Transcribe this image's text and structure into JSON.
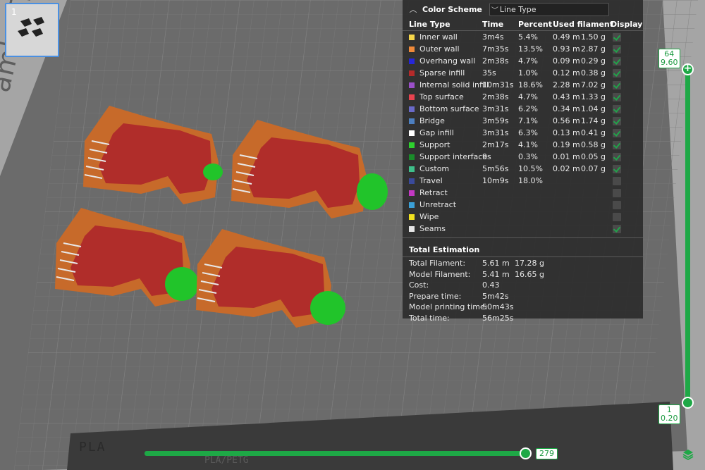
{
  "plate": {
    "label": "ambu Textured PEI Plate",
    "bottom_logo": "PLA",
    "bottom_text": "PLA/PETG"
  },
  "thumbnail": {
    "number": "1"
  },
  "legend": {
    "title": "Color Scheme",
    "scheme_value": "Line Type",
    "columns": {
      "type": "Line Type",
      "time": "Time",
      "percent": "Percent",
      "used": "Used filament",
      "display": "Display"
    },
    "rows": [
      {
        "name": "Inner wall",
        "color": "#f5d64a",
        "time": "3m4s",
        "percent": "5.4%",
        "m": "0.49 m",
        "g": "1.50 g",
        "display": true
      },
      {
        "name": "Outer wall",
        "color": "#f08a3a",
        "time": "7m35s",
        "percent": "13.5%",
        "m": "0.93 m",
        "g": "2.87 g",
        "display": true
      },
      {
        "name": "Overhang wall",
        "color": "#2727d8",
        "time": "2m38s",
        "percent": "4.7%",
        "m": "0.09 m",
        "g": "0.29 g",
        "display": true
      },
      {
        "name": "Sparse infill",
        "color": "#b52a2a",
        "time": "35s",
        "percent": "1.0%",
        "m": "0.12 m",
        "g": "0.38 g",
        "display": true
      },
      {
        "name": "Internal solid infill",
        "color": "#9b4fc9",
        "time": "10m31s",
        "percent": "18.6%",
        "m": "2.28 m",
        "g": "7.02 g",
        "display": true
      },
      {
        "name": "Top surface",
        "color": "#e8434f",
        "time": "2m38s",
        "percent": "4.7%",
        "m": "0.43 m",
        "g": "1.33 g",
        "display": true
      },
      {
        "name": "Bottom surface",
        "color": "#6a6ac9",
        "time": "3m31s",
        "percent": "6.2%",
        "m": "0.34 m",
        "g": "1.04 g",
        "display": true
      },
      {
        "name": "Bridge",
        "color": "#4d7fc0",
        "time": "3m59s",
        "percent": "7.1%",
        "m": "0.56 m",
        "g": "1.74 g",
        "display": true
      },
      {
        "name": "Gap infill",
        "color": "#ffffff",
        "time": "3m31s",
        "percent": "6.3%",
        "m": "0.13 m",
        "g": "0.41 g",
        "display": true
      },
      {
        "name": "Support",
        "color": "#2ed12e",
        "time": "2m17s",
        "percent": "4.1%",
        "m": "0.19 m",
        "g": "0.58 g",
        "display": true
      },
      {
        "name": "Support interface",
        "color": "#1a8c2a",
        "time": "9s",
        "percent": "0.3%",
        "m": "0.01 m",
        "g": "0.05 g",
        "display": true
      },
      {
        "name": "Custom",
        "color": "#3fbf8a",
        "time": "5m56s",
        "percent": "10.5%",
        "m": "0.02 m",
        "g": "0.07 g",
        "display": true
      },
      {
        "name": "Travel",
        "color": "#3a4a9a",
        "time": "10m9s",
        "percent": "18.0%",
        "m": "",
        "g": "",
        "display": false
      },
      {
        "name": "Retract",
        "color": "#c238c2",
        "time": "",
        "percent": "",
        "m": "",
        "g": "",
        "display": false
      },
      {
        "name": "Unretract",
        "color": "#3a9fd6",
        "time": "",
        "percent": "",
        "m": "",
        "g": "",
        "display": false
      },
      {
        "name": "Wipe",
        "color": "#f2e21f",
        "time": "",
        "percent": "",
        "m": "",
        "g": "",
        "display": false
      },
      {
        "name": "Seams",
        "color": "#e6e6e6",
        "time": "",
        "percent": "",
        "m": "",
        "g": "",
        "display": true
      }
    ]
  },
  "totals": {
    "title": "Total Estimation",
    "rows": [
      {
        "label": "Total Filament:",
        "v1": "5.61 m",
        "v2": "17.28 g"
      },
      {
        "label": "Model Filament:",
        "v1": "5.41 m",
        "v2": "16.65 g"
      },
      {
        "label": "Cost:",
        "v1": "0.43",
        "v2": ""
      },
      {
        "label": "Prepare time:",
        "v1": "5m42s",
        "v2": ""
      },
      {
        "label": "Model printing time:",
        "v1": "50m43s",
        "v2": ""
      },
      {
        "label": "Total time:",
        "v1": "56m25s",
        "v2": ""
      }
    ]
  },
  "layer_slider": {
    "top_layer": "64",
    "top_height": "9.60",
    "bottom_layer": "1",
    "bottom_height": "0.20"
  },
  "move_slider": {
    "value": "279"
  },
  "icons": {
    "collapse": "chevron-up-icon",
    "dropdown": "chevron-down-icon",
    "add": "plus-icon",
    "layers": "layers-icon"
  }
}
